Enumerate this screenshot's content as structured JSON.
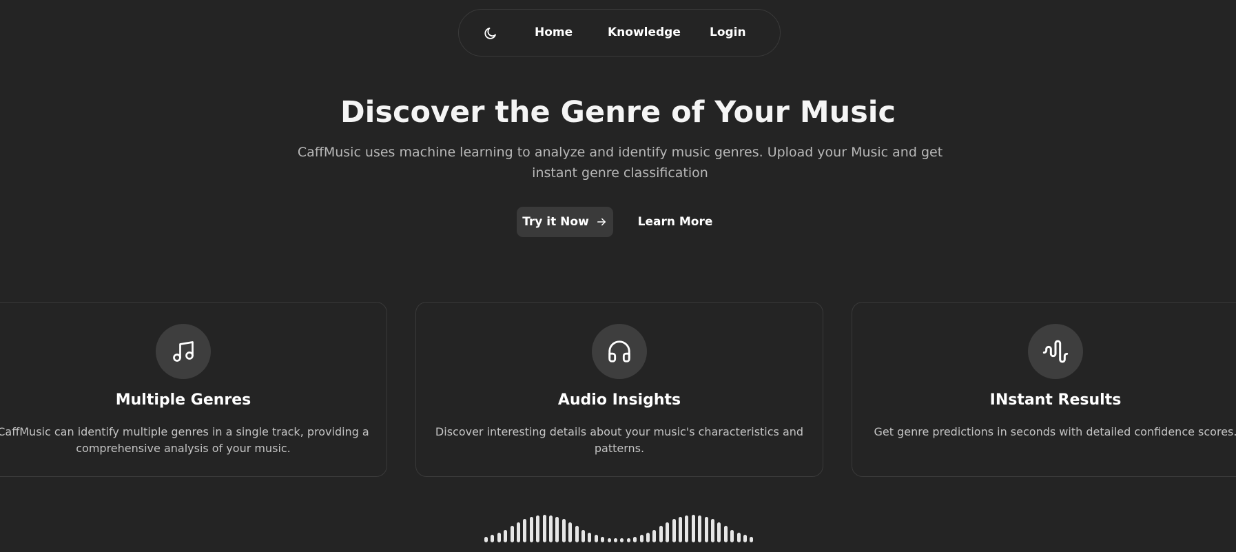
{
  "nav": {
    "theme_icon": "moon-icon",
    "items": [
      {
        "label": "Home"
      },
      {
        "label": "Knowledge"
      },
      {
        "label": "Login"
      }
    ]
  },
  "hero": {
    "title": "Discover the Genre of Your Music",
    "subtitle": "CaffMusic uses machine learning to analyze and identify music genres. Upload your Music and get instant genre classification",
    "primary_button": "Try it Now",
    "primary_button_icon": "arrow-right-icon",
    "secondary_button": "Learn More"
  },
  "features": [
    {
      "icon": "music-note-icon",
      "title": "Multiple Genres",
      "description": "CaffMusic can identify multiple genres in a single track, providing a comprehensive analysis of your music."
    },
    {
      "icon": "headphones-icon",
      "title": "Audio Insights",
      "description": "Discover interesting details about your music's characteristics and patterns."
    },
    {
      "icon": "audio-wave-icon",
      "title": "INstant Results",
      "description": "Get genre predictions in seconds with detailed confidence scores."
    }
  ],
  "colors": {
    "background": "#242424",
    "card_border": "#3a3a3a",
    "icon_circle": "#3e3e3e",
    "primary_button": "#3a3a3a",
    "text": "#ffffff",
    "muted_text": "#b8b8b8"
  },
  "waveform": {
    "icon": "audio-visualizer",
    "levels": [
      0.2,
      0.27,
      0.35,
      0.45,
      0.6,
      0.72,
      0.85,
      0.92,
      0.97,
      1.0,
      0.97,
      0.92,
      0.85,
      0.72,
      0.6,
      0.45,
      0.35,
      0.27,
      0.2,
      0.15,
      0.12,
      0.12,
      0.15,
      0.2,
      0.27,
      0.35,
      0.45,
      0.6,
      0.72,
      0.85,
      0.92,
      0.97,
      1.0,
      0.97,
      0.92,
      0.85,
      0.72,
      0.6,
      0.45,
      0.35,
      0.27,
      0.2
    ]
  }
}
